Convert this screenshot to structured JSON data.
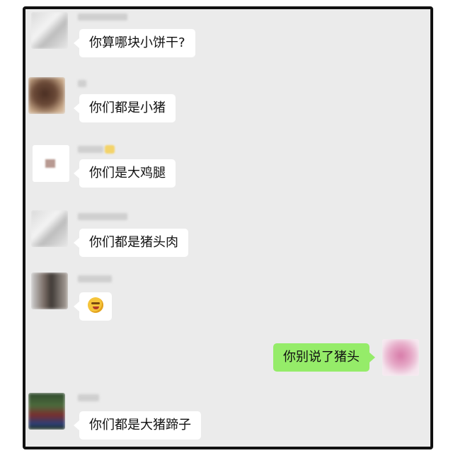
{
  "chat": {
    "messages": [
      {
        "sender": "left",
        "text": "你算哪块小饼干?"
      },
      {
        "sender": "left",
        "text": "你们都是小猪"
      },
      {
        "sender": "left",
        "text": "你们是大鸡腿"
      },
      {
        "sender": "left",
        "text": "你们都是猪头肉"
      },
      {
        "sender": "left",
        "emoji": "laughing-tears-emoji"
      },
      {
        "sender": "right",
        "text": "你别说了猪头"
      },
      {
        "sender": "left",
        "text": "你们都是大猪蹄子"
      }
    ]
  },
  "colors": {
    "chat_background": "#ebebeb",
    "incoming_bubble": "#ffffff",
    "outgoing_bubble": "#95ec69",
    "frame_border": "#111111"
  }
}
